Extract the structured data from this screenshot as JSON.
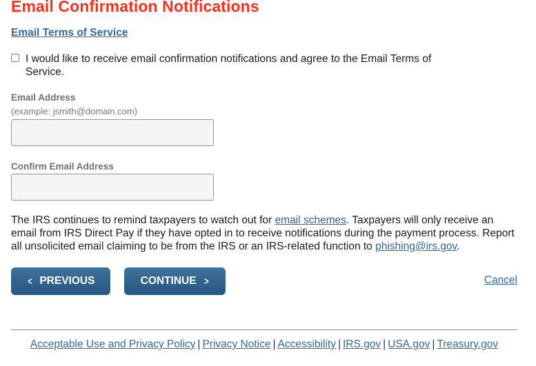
{
  "page": {
    "title": "Email Confirmation Notifications",
    "terms_link": "Email Terms of Service",
    "accent_color": "#f5301c",
    "link_color": "#2f6a9b"
  },
  "consent": {
    "checked": false,
    "label": "I would like to receive email confirmation notifications and agree to the Email Terms of Service."
  },
  "form": {
    "email": {
      "label": "Email Address",
      "hint": "(example: jsmith@domain.com)",
      "value": ""
    },
    "confirm_email": {
      "label": "Confirm Email Address",
      "value": ""
    }
  },
  "notice": {
    "part1": "The IRS continues to remind taxpayers to watch out for ",
    "link1": "email schemes",
    "part2": ". Taxpayers will only receive an email from IRS Direct Pay if they have opted in to receive notifications during the payment process. Report all unsolicited email claiming to be from the IRS or an IRS-related function to ",
    "link2": "phishing@irs.gov",
    "part3": "."
  },
  "actions": {
    "previous": "PREVIOUS",
    "continue": "CONTINUE",
    "cancel": "Cancel"
  },
  "footer": {
    "links": [
      "Acceptable Use and Privacy Policy",
      "Privacy Notice",
      "Accessibility",
      "IRS.gov",
      "USA.gov",
      "Treasury.gov"
    ],
    "separator": "|"
  }
}
